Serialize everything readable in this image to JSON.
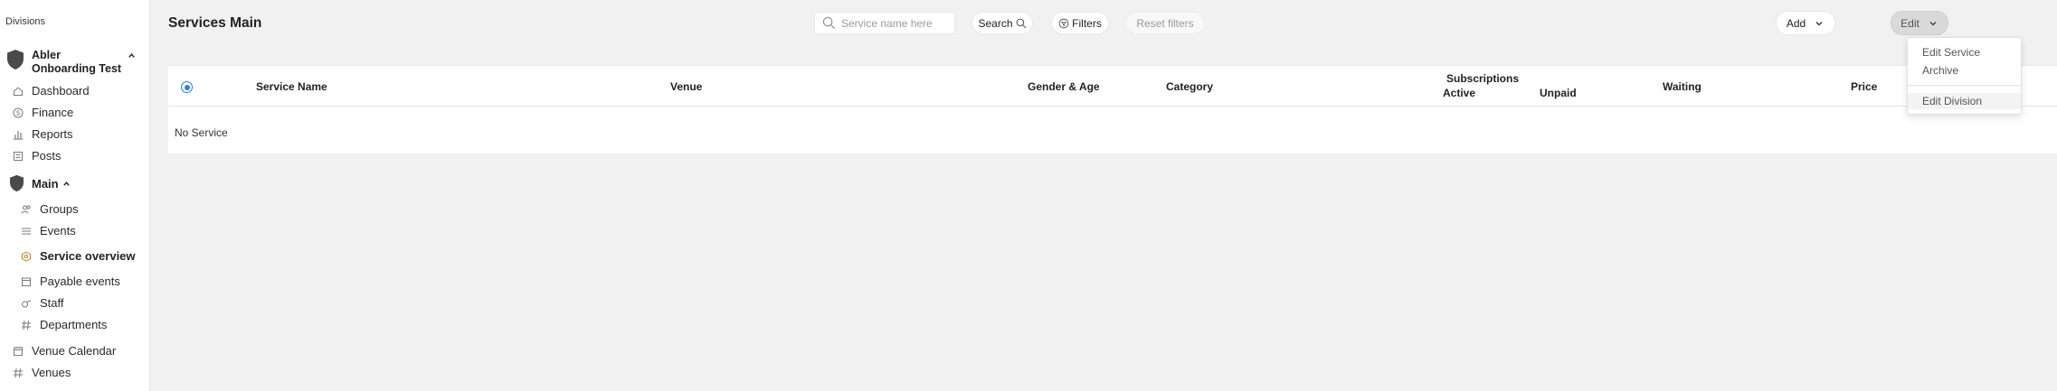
{
  "sidebar": {
    "heading": "Divisions",
    "organization": "Abler Onboarding Test",
    "items_top": [
      {
        "label": "Dashboard",
        "icon": "home-icon"
      },
      {
        "label": "Finance",
        "icon": "dollar-circle-icon"
      },
      {
        "label": "Reports",
        "icon": "bar-chart-icon"
      },
      {
        "label": "Posts",
        "icon": "document-icon"
      }
    ],
    "group": "Main",
    "group_items": [
      {
        "label": "Groups",
        "icon": "users-icon"
      },
      {
        "label": "Events",
        "icon": "list-icon"
      },
      {
        "label": "Service overview",
        "icon": "hexagon-gear-icon",
        "active": true
      },
      {
        "label": "Payable events",
        "icon": "calendar-dollar-icon"
      },
      {
        "label": "Staff",
        "icon": "whistle-icon"
      },
      {
        "label": "Departments",
        "icon": "hash-icon"
      }
    ],
    "items_bottom": [
      {
        "label": "Venue Calendar",
        "icon": "calendar-icon"
      },
      {
        "label": "Venues",
        "icon": "hash-icon"
      }
    ]
  },
  "header": {
    "title": "Services Main",
    "search_placeholder": "Service name here",
    "search_value": "",
    "search_button": "Search",
    "filters_button": "Filters",
    "reset_button": "Reset filters",
    "add_button": "Add",
    "edit_button": "Edit"
  },
  "table": {
    "columns": {
      "service_name": "Service Name",
      "venue": "Venue",
      "gender_age": "Gender & Age",
      "category": "Category",
      "subscriptions": "Subscriptions",
      "active": "Active",
      "unpaid": "Unpaid",
      "waiting": "Waiting",
      "price": "Price"
    },
    "empty_text": "No Service"
  },
  "dropdown": {
    "items": [
      "Edit Service",
      "Archive",
      "Edit Division"
    ]
  },
  "colors": {
    "accent": "#2d7be5",
    "background": "#f1f1f1",
    "sidebar": "#ffffff"
  }
}
